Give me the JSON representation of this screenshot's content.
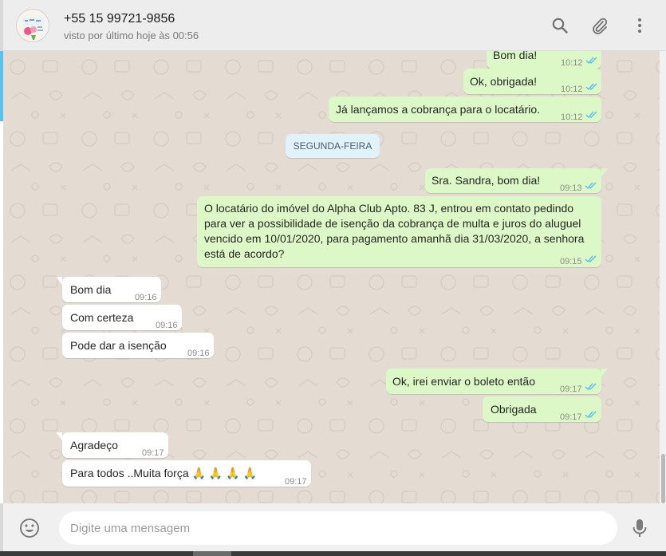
{
  "contact": {
    "name": "+55 15 99721-9856",
    "last_seen": "visto por último hoje às 00:56"
  },
  "header_icons": [
    "search-icon",
    "attach-icon",
    "menu-icon"
  ],
  "colors": {
    "outgoing_bubble": "#dcf8c6",
    "incoming_bubble": "#ffffff",
    "chat_background": "#e4dcd3",
    "read_ticks": "#4fc3f7",
    "day_badge": "#e1f2fb"
  },
  "day_separator": "SEGUNDA-FEIRA",
  "messages": [
    {
      "text": "Bom dia!",
      "time": "10:12"
    },
    {
      "text": "Ok, obrigada!",
      "time": "10:12"
    },
    {
      "text": "Já lançamos a cobrança para o locatário.",
      "time": "10:12"
    },
    {
      "text": "Sra. Sandra, bom dia!",
      "time": "09:13"
    },
    {
      "lines": [
        "O locatário do imóvel do Alpha Club Apto. 83 J, entrou em contato pedindo",
        "para ver a possibilidade de isenção da cobrança de multa e juros do aluguel",
        "vencido em 10/01/2020, para pagamento amanhã dia 31/03/2020, a senhora",
        "está de acordo?"
      ],
      "time": "09:15"
    },
    {
      "text": "Bom dia",
      "time": "09:16"
    },
    {
      "text": "Com certeza",
      "time": "09:16"
    },
    {
      "text": "Pode dar a isenção",
      "time": "09:16"
    },
    {
      "text": "Ok, irei enviar o boleto então",
      "time": "09:17"
    },
    {
      "text": "Obrigada",
      "time": "09:17"
    },
    {
      "text": "Agradeço",
      "time": "09:17"
    },
    {
      "text": "Para todos ..Muita força 🙏 🙏 🙏 🙏",
      "time": "09:17"
    }
  ],
  "composer": {
    "placeholder": "Digite uma mensagem"
  },
  "footer_icons": [
    "emoji-icon",
    "microphone-icon"
  ]
}
